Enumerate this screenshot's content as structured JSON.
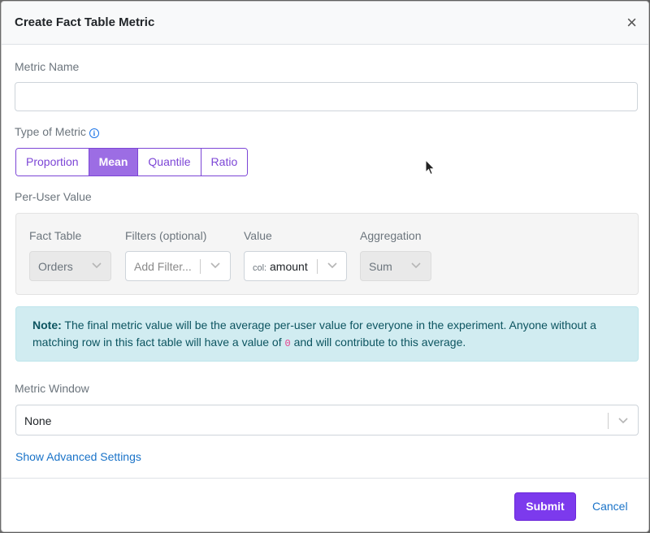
{
  "modal": {
    "title": "Create Fact Table Metric",
    "close_glyph": "×"
  },
  "metric_name": {
    "label": "Metric Name",
    "value": "",
    "placeholder": ""
  },
  "metric_type": {
    "label": "Type of Metric",
    "options": [
      "Proportion",
      "Mean",
      "Quantile",
      "Ratio"
    ],
    "selected": "Mean"
  },
  "per_user": {
    "label": "Per-User Value",
    "fact_table": {
      "label": "Fact Table",
      "value": "Orders"
    },
    "filters": {
      "label": "Filters (optional)",
      "placeholder": "Add Filter..."
    },
    "value": {
      "label": "Value",
      "prefix": "col:",
      "value": "amount"
    },
    "aggregation": {
      "label": "Aggregation",
      "value": "Sum"
    }
  },
  "note": {
    "bold": "Note:",
    "text_before": " The final metric value will be the average per-user value for everyone in the experiment. Anyone without a matching row in this fact table will have a value of ",
    "code": "0",
    "text_after": " and will contribute to this average."
  },
  "metric_window": {
    "label": "Metric Window",
    "value": "None"
  },
  "advanced_link": "Show Advanced Settings",
  "footer": {
    "submit": "Submit",
    "cancel": "Cancel"
  },
  "colors": {
    "accent": "#7c3aed",
    "segment_active": "#9c6de4",
    "note_bg": "#d1ecf1",
    "link": "#1a73c8"
  },
  "icons": {
    "close": "close-icon",
    "info": "info-icon",
    "chevron": "chevron-down-icon",
    "cursor": "mouse-cursor-icon"
  }
}
